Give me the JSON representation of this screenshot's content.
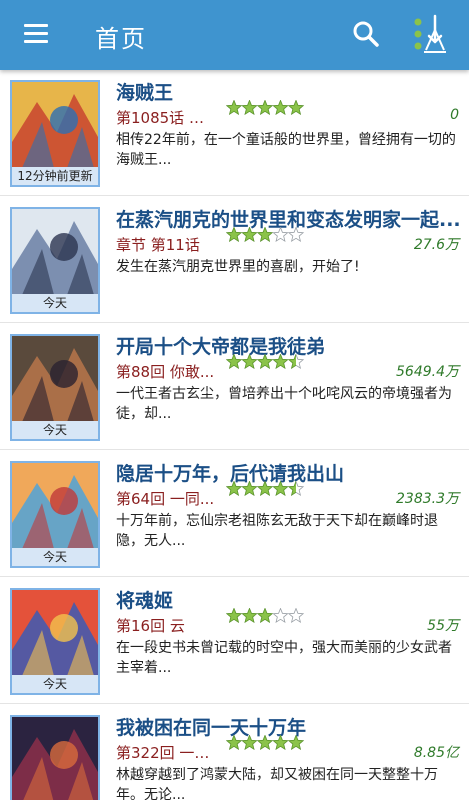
{
  "app": {
    "title": "首页"
  },
  "colors": {
    "accent": "#3f94cf",
    "title": "#1b4f86",
    "chapter": "#8a1f1f",
    "views": "#2f7a2a",
    "star_on": "#8bc34a"
  },
  "icons": {
    "menu": "menu-icon",
    "search": "search-icon",
    "more": "more-options-icon"
  },
  "books": [
    {
      "title": "海贼王",
      "chapter": "第1085话 试...",
      "rating": 5,
      "views": "0",
      "description": "相传22年前，在一个童话般的世界里，曾经拥有一切的海贼王...",
      "updated": "12分钟前更新",
      "cover_colors": [
        "#e7b54a",
        "#c8442f",
        "#2d6fb3"
      ]
    },
    {
      "title": "在蒸汽朋克的世界里和变态发明家一起...",
      "chapter": "章节 第11话",
      "rating": 3,
      "views": "27.6万",
      "description": "发生在蒸汽朋克世界里的喜剧，开始了!",
      "updated": "今天",
      "cover_colors": [
        "#dfe7ef",
        "#6b7fa5",
        "#2c3550"
      ]
    },
    {
      "title": "开局十个大帝都是我徒弟",
      "chapter": "第88回 你敢...",
      "rating": 4.5,
      "views": "5649.4万",
      "description": "一代王者古玄尘，曾培养出十个叱咤风云的帝境强者为徒，却...",
      "updated": "今天",
      "cover_colors": [
        "#5a4a3c",
        "#b8754a",
        "#2a2230"
      ]
    },
    {
      "title": "隐居十万年，后代请我出山",
      "chapter": "第64回 一同...",
      "rating": 4.5,
      "views": "2383.3万",
      "description": "十万年前，忘仙宗老祖陈玄无敌于天下却在巅峰时退隐，无人...",
      "updated": "今天",
      "cover_colors": [
        "#f0a85a",
        "#4fa3d9",
        "#c03a3a"
      ]
    },
    {
      "title": "将魂姬",
      "chapter": "第16回 云",
      "rating": 3,
      "views": "55万",
      "description": "在一段史书未曾记载的时空中，强大而美丽的少女武者主宰着...",
      "updated": "今天",
      "cover_colors": [
        "#e4523a",
        "#3c5bb5",
        "#f2c24e"
      ]
    },
    {
      "title": "我被困在同一天十万年",
      "chapter": "第322回 一个...",
      "rating": 5,
      "views": "8.85亿",
      "description": "林越穿越到了鸿蒙大陆，却又被困在同一天整整十万年。无论...",
      "updated": "今天",
      "cover_colors": [
        "#2b2340",
        "#8c2f4a",
        "#d86a3c"
      ]
    }
  ]
}
